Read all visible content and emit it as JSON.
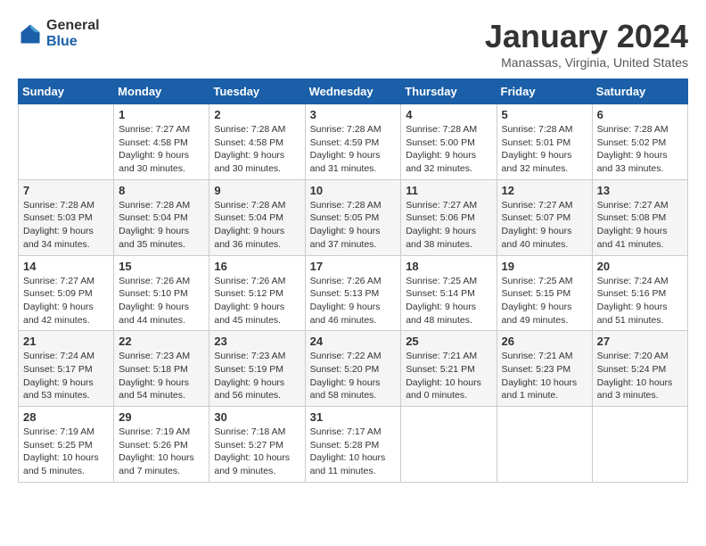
{
  "logo": {
    "general": "General",
    "blue": "Blue"
  },
  "title": "January 2024",
  "location": "Manassas, Virginia, United States",
  "days_of_week": [
    "Sunday",
    "Monday",
    "Tuesday",
    "Wednesday",
    "Thursday",
    "Friday",
    "Saturday"
  ],
  "weeks": [
    [
      {
        "day": "",
        "info": ""
      },
      {
        "day": "1",
        "info": "Sunrise: 7:27 AM\nSunset: 4:58 PM\nDaylight: 9 hours\nand 30 minutes."
      },
      {
        "day": "2",
        "info": "Sunrise: 7:28 AM\nSunset: 4:58 PM\nDaylight: 9 hours\nand 30 minutes."
      },
      {
        "day": "3",
        "info": "Sunrise: 7:28 AM\nSunset: 4:59 PM\nDaylight: 9 hours\nand 31 minutes."
      },
      {
        "day": "4",
        "info": "Sunrise: 7:28 AM\nSunset: 5:00 PM\nDaylight: 9 hours\nand 32 minutes."
      },
      {
        "day": "5",
        "info": "Sunrise: 7:28 AM\nSunset: 5:01 PM\nDaylight: 9 hours\nand 32 minutes."
      },
      {
        "day": "6",
        "info": "Sunrise: 7:28 AM\nSunset: 5:02 PM\nDaylight: 9 hours\nand 33 minutes."
      }
    ],
    [
      {
        "day": "7",
        "info": "Sunrise: 7:28 AM\nSunset: 5:03 PM\nDaylight: 9 hours\nand 34 minutes."
      },
      {
        "day": "8",
        "info": "Sunrise: 7:28 AM\nSunset: 5:04 PM\nDaylight: 9 hours\nand 35 minutes."
      },
      {
        "day": "9",
        "info": "Sunrise: 7:28 AM\nSunset: 5:04 PM\nDaylight: 9 hours\nand 36 minutes."
      },
      {
        "day": "10",
        "info": "Sunrise: 7:28 AM\nSunset: 5:05 PM\nDaylight: 9 hours\nand 37 minutes."
      },
      {
        "day": "11",
        "info": "Sunrise: 7:27 AM\nSunset: 5:06 PM\nDaylight: 9 hours\nand 38 minutes."
      },
      {
        "day": "12",
        "info": "Sunrise: 7:27 AM\nSunset: 5:07 PM\nDaylight: 9 hours\nand 40 minutes."
      },
      {
        "day": "13",
        "info": "Sunrise: 7:27 AM\nSunset: 5:08 PM\nDaylight: 9 hours\nand 41 minutes."
      }
    ],
    [
      {
        "day": "14",
        "info": "Sunrise: 7:27 AM\nSunset: 5:09 PM\nDaylight: 9 hours\nand 42 minutes."
      },
      {
        "day": "15",
        "info": "Sunrise: 7:26 AM\nSunset: 5:10 PM\nDaylight: 9 hours\nand 44 minutes."
      },
      {
        "day": "16",
        "info": "Sunrise: 7:26 AM\nSunset: 5:12 PM\nDaylight: 9 hours\nand 45 minutes."
      },
      {
        "day": "17",
        "info": "Sunrise: 7:26 AM\nSunset: 5:13 PM\nDaylight: 9 hours\nand 46 minutes."
      },
      {
        "day": "18",
        "info": "Sunrise: 7:25 AM\nSunset: 5:14 PM\nDaylight: 9 hours\nand 48 minutes."
      },
      {
        "day": "19",
        "info": "Sunrise: 7:25 AM\nSunset: 5:15 PM\nDaylight: 9 hours\nand 49 minutes."
      },
      {
        "day": "20",
        "info": "Sunrise: 7:24 AM\nSunset: 5:16 PM\nDaylight: 9 hours\nand 51 minutes."
      }
    ],
    [
      {
        "day": "21",
        "info": "Sunrise: 7:24 AM\nSunset: 5:17 PM\nDaylight: 9 hours\nand 53 minutes."
      },
      {
        "day": "22",
        "info": "Sunrise: 7:23 AM\nSunset: 5:18 PM\nDaylight: 9 hours\nand 54 minutes."
      },
      {
        "day": "23",
        "info": "Sunrise: 7:23 AM\nSunset: 5:19 PM\nDaylight: 9 hours\nand 56 minutes."
      },
      {
        "day": "24",
        "info": "Sunrise: 7:22 AM\nSunset: 5:20 PM\nDaylight: 9 hours\nand 58 minutes."
      },
      {
        "day": "25",
        "info": "Sunrise: 7:21 AM\nSunset: 5:21 PM\nDaylight: 10 hours\nand 0 minutes."
      },
      {
        "day": "26",
        "info": "Sunrise: 7:21 AM\nSunset: 5:23 PM\nDaylight: 10 hours\nand 1 minute."
      },
      {
        "day": "27",
        "info": "Sunrise: 7:20 AM\nSunset: 5:24 PM\nDaylight: 10 hours\nand 3 minutes."
      }
    ],
    [
      {
        "day": "28",
        "info": "Sunrise: 7:19 AM\nSunset: 5:25 PM\nDaylight: 10 hours\nand 5 minutes."
      },
      {
        "day": "29",
        "info": "Sunrise: 7:19 AM\nSunset: 5:26 PM\nDaylight: 10 hours\nand 7 minutes."
      },
      {
        "day": "30",
        "info": "Sunrise: 7:18 AM\nSunset: 5:27 PM\nDaylight: 10 hours\nand 9 minutes."
      },
      {
        "day": "31",
        "info": "Sunrise: 7:17 AM\nSunset: 5:28 PM\nDaylight: 10 hours\nand 11 minutes."
      },
      {
        "day": "",
        "info": ""
      },
      {
        "day": "",
        "info": ""
      },
      {
        "day": "",
        "info": ""
      }
    ]
  ]
}
